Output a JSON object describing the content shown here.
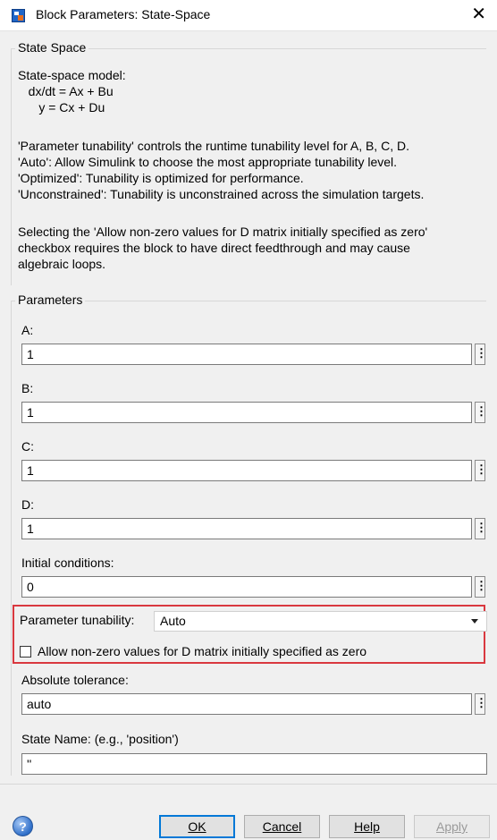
{
  "window": {
    "title": "Block Parameters: State-Space",
    "close_glyph": "✕"
  },
  "state_space_group": {
    "label": "State Space",
    "description_lines": [
      "State-space model:",
      "   dx/dt = Ax + Bu",
      "      y = Cx + Du",
      "",
      "'Parameter tunability' controls the runtime tunability level for A, B, C, D.",
      "'Auto': Allow Simulink to choose the most appropriate tunability level.",
      "'Optimized': Tunability is optimized for performance.",
      "'Unconstrained': Tunability is unconstrained across the simulation targets.",
      "",
      "Selecting the 'Allow non-zero values for D matrix initially specified as zero'",
      "checkbox requires the block to have direct feedthrough and may cause",
      "algebraic loops."
    ]
  },
  "parameters_group": {
    "label": "Parameters",
    "fields": [
      {
        "label": "A:",
        "value": "1"
      },
      {
        "label": "B:",
        "value": "1"
      },
      {
        "label": "C:",
        "value": "1"
      },
      {
        "label": "D:",
        "value": "1"
      },
      {
        "label": "Initial conditions:",
        "value": "0"
      }
    ],
    "tunability": {
      "label": "Parameter tunability:",
      "selected": "Auto"
    },
    "checkbox": {
      "label": "Allow non-zero values for D matrix initially specified as zero",
      "checked": false
    },
    "abs_tol": {
      "label": "Absolute tolerance:",
      "value": "auto"
    },
    "state_name": {
      "label": "State Name: (e.g., 'position')",
      "value": "''"
    },
    "more_glyph": "⋮",
    "highlight_color": "#d9383f"
  },
  "buttons": {
    "help_icon": "?",
    "ok": "OK",
    "cancel": "Cancel",
    "help": "Help",
    "apply": "Apply"
  }
}
